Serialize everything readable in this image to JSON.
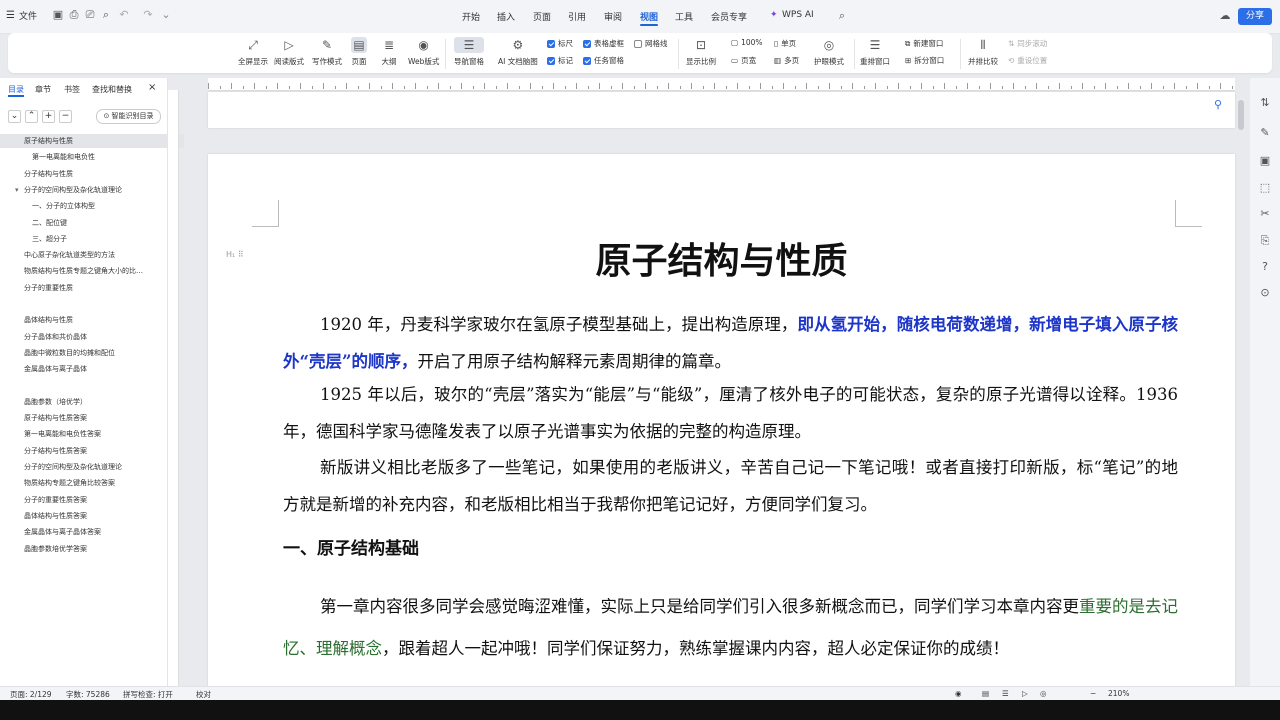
{
  "topbar": {
    "file_label": "文件",
    "menus": [
      "开始",
      "插入",
      "页面",
      "引用",
      "审阅",
      "视图",
      "工具",
      "会员专享",
      "WPS AI"
    ],
    "active_menu": "视图",
    "share_label": "分享"
  },
  "ribbon": {
    "buttons": [
      "全屏显示",
      "阅读版式",
      "写作模式",
      "页面",
      "大纲",
      "Web版式",
      "导航窗格",
      "AI 文档脑图"
    ],
    "checkboxes": [
      {
        "label": "标尺",
        "checked": true
      },
      {
        "label": "表格虚框",
        "checked": true
      },
      {
        "label": "网格线",
        "checked": false
      },
      {
        "label": "标记",
        "checked": true
      },
      {
        "label": "任务窗格",
        "checked": true
      }
    ],
    "zoom_buttons": [
      "显示比例",
      "100%",
      "单页",
      "页宽",
      "多页"
    ],
    "eye_mode": "护眼模式",
    "window_buttons": [
      "重排窗口",
      "新建窗口",
      "拆分窗口"
    ],
    "compare_buttons": [
      "并排比较",
      "同步滚动",
      "重设位置"
    ]
  },
  "nav": {
    "tabs": [
      "目录",
      "章节",
      "书签",
      "查找和替换"
    ],
    "smart_toc_label": "智能识别目录",
    "toc_items": [
      {
        "label": "原子结构与性质",
        "indent": 0,
        "selected": true
      },
      {
        "label": "第一电离能和电负性",
        "indent": 1
      },
      {
        "label": "分子结构与性质",
        "indent": 0
      },
      {
        "label": "分子的空间构型及杂化轨道理论",
        "indent": 0,
        "arrow": true
      },
      {
        "label": "一、分子的立体构型",
        "indent": 1
      },
      {
        "label": "二、配位键",
        "indent": 1
      },
      {
        "label": "三、超分子",
        "indent": 1
      },
      {
        "label": "中心原子杂化轨道类型的方法",
        "indent": 0
      },
      {
        "label": "物质结构与性质专题之键角大小的比…",
        "indent": 0
      },
      {
        "label": "分子的重要性质",
        "indent": 0
      },
      {
        "label": "",
        "indent": 0
      },
      {
        "label": "晶体结构与性质",
        "indent": 0
      },
      {
        "label": "分子晶体和共价晶体",
        "indent": 0
      },
      {
        "label": "晶胞中微粒数目的均摊和配位",
        "indent": 0
      },
      {
        "label": "金属晶体与离子晶体",
        "indent": 0
      },
      {
        "label": "",
        "indent": 0
      },
      {
        "label": "晶胞参数（培优学）",
        "indent": 0
      },
      {
        "label": "原子结构与性质答案",
        "indent": 0
      },
      {
        "label": "第一电离能和电负性答案",
        "indent": 0
      },
      {
        "label": "分子结构与性质答案",
        "indent": 0
      },
      {
        "label": "分子的空间构型及杂化轨道理论",
        "indent": 0
      },
      {
        "label": "物质结构专题之键角比较答案",
        "indent": 0
      },
      {
        "label": "分子的重要性质答案",
        "indent": 0
      },
      {
        "label": "晶体结构与性质答案",
        "indent": 0
      },
      {
        "label": "金属晶体与离子晶体答案",
        "indent": 0
      },
      {
        "label": "晶胞参数培优学答案",
        "indent": 0
      }
    ]
  },
  "doc": {
    "title": "原子结构与性质",
    "p1_a": "1920 年，丹麦科学家玻尔在氢原子模型基础上，提出构造原理，",
    "p1_b": "即从氢开始，随核电荷数递增，新增电子填入原子核外“壳层”的顺序，",
    "p1_c": "开启了用原子结构解释元素周期律的篇章。",
    "p2": "1925 年以后，玻尔的“壳层”落实为“能层”与“能级”，厘清了核外电子的可能状态，复杂的原子光谱得以诠释。1936 年，德国科学家马德隆发表了以原子光谱事实为依据的完整的构造原理。",
    "p3": "新版讲义相比老版多了一些笔记，如果使用的老版讲义，辛苦自己记一下笔记哦！或者直接打印新版，标“笔记”的地方就是新增的补充内容，和老版相比相当于我帮你把笔记记好，方便同学们复习。",
    "heading1": "一、原子结构基础",
    "p4_a": "第一章内容很多同学会感觉晦涩难懂，实际上只是给同学们引入很多新概念而已，同学们学习本章内容更",
    "p4_b": "重要的是去记忆、理解概念",
    "p4_c": "，跟着超人一起冲哦！同学们保证努力，熟练掌握课内内容，超人必定保证你的成绩！"
  },
  "status": {
    "page": "页面: 2/129",
    "words": "字数: 75286",
    "spell": "拼写检查: 打开",
    "proof": "校对",
    "zoom": "210%"
  },
  "colors": {
    "accent": "#1f63d8",
    "blue_text": "#1d35c9",
    "green_text": "#2c6e2f"
  }
}
